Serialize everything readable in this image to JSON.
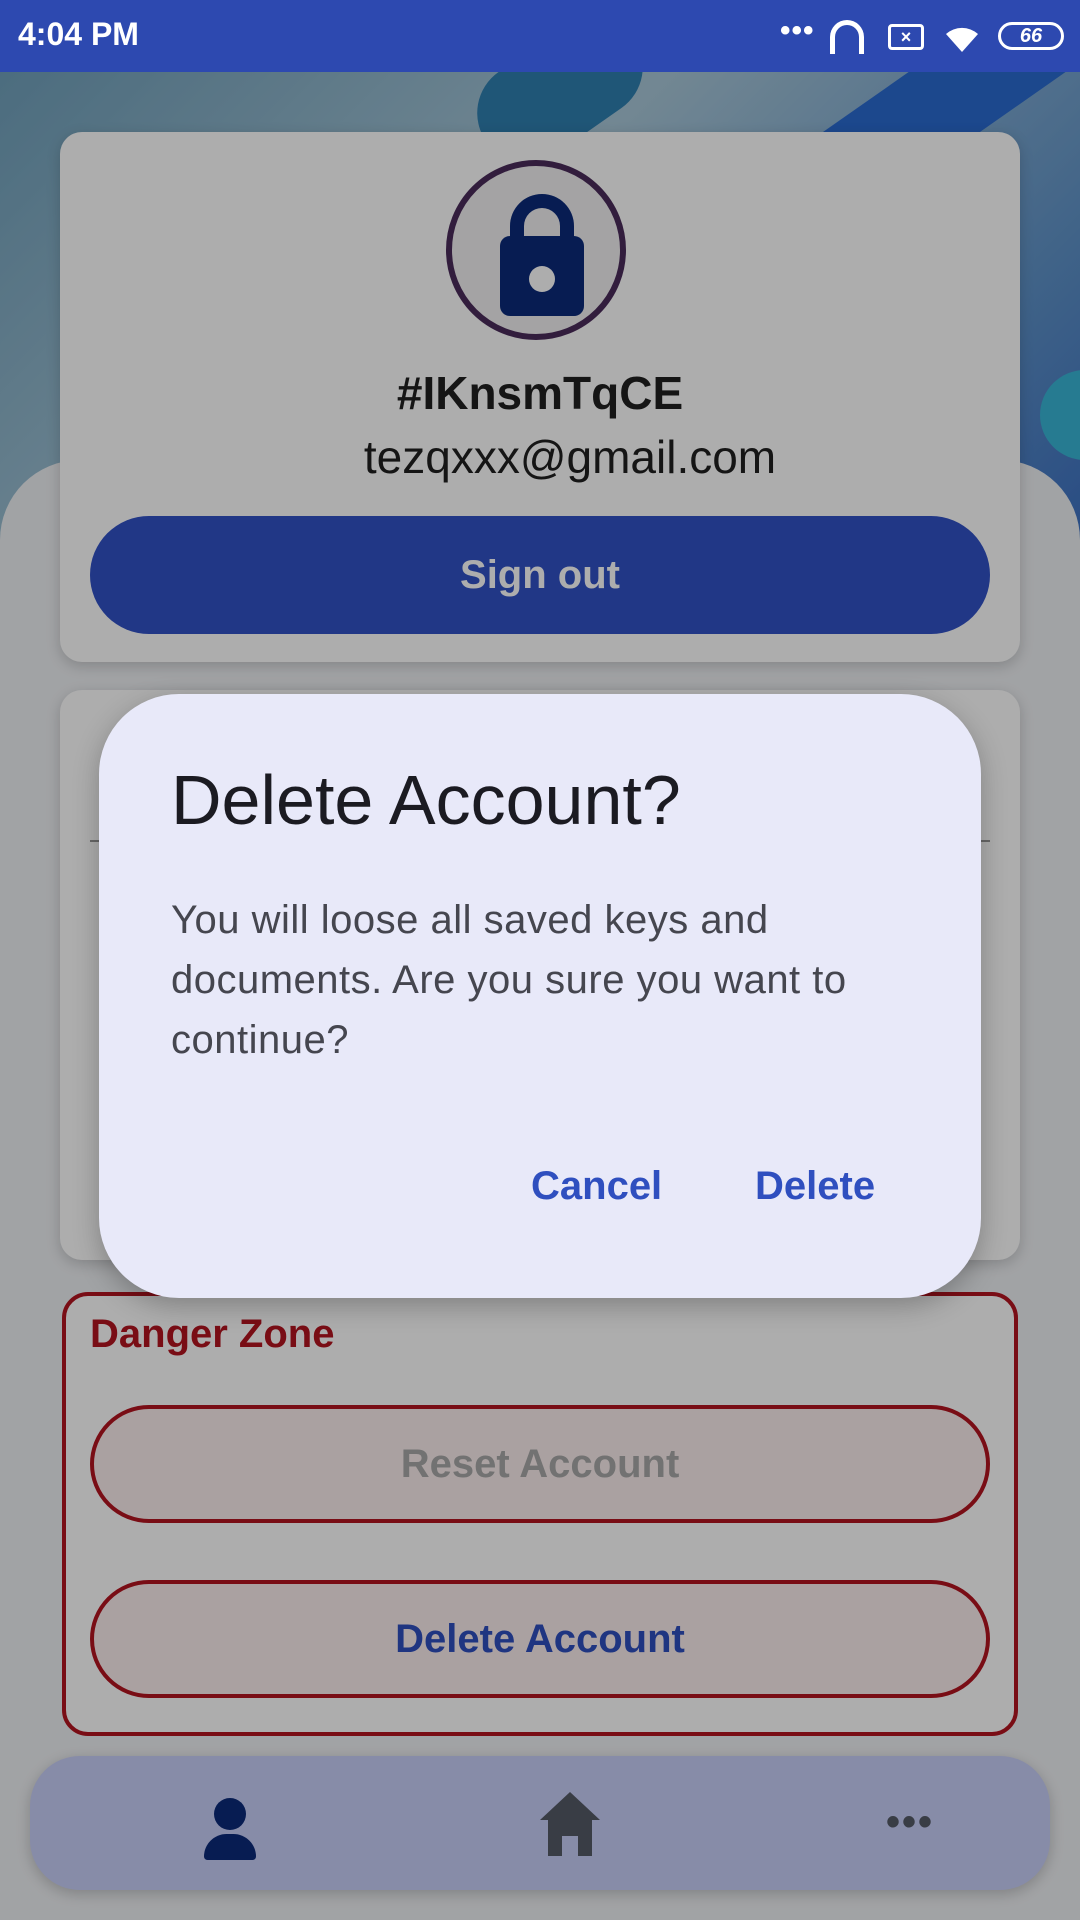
{
  "status_bar": {
    "time": "4:04 PM",
    "battery": "66",
    "icons": [
      "more-dots-icon",
      "headphones-icon",
      "no-sim-icon",
      "wifi-icon",
      "battery-icon"
    ]
  },
  "profile": {
    "avatar_icon": "lock-icon",
    "user_id": "#IKnsmTqCE",
    "email": "tezqxxx@gmail.com",
    "sign_out_label": "Sign out"
  },
  "danger_zone": {
    "title": "Danger Zone",
    "reset_label": "Reset Account",
    "delete_label": "Delete Account"
  },
  "bottom_nav": {
    "items": [
      {
        "icon": "person-icon",
        "selected": true
      },
      {
        "icon": "home-icon",
        "selected": false
      },
      {
        "icon": "more-horizontal-icon",
        "selected": false
      }
    ]
  },
  "dialog": {
    "title": "Delete Account?",
    "message": "You will loose all saved keys and documents. Are you sure you want to continue?",
    "cancel_label": "Cancel",
    "confirm_label": "Delete"
  },
  "colors": {
    "primary": "#3151c6",
    "danger": "#b3141f",
    "dialog_bg": "#e8e9f9",
    "status_bar": "#2d49b0"
  }
}
